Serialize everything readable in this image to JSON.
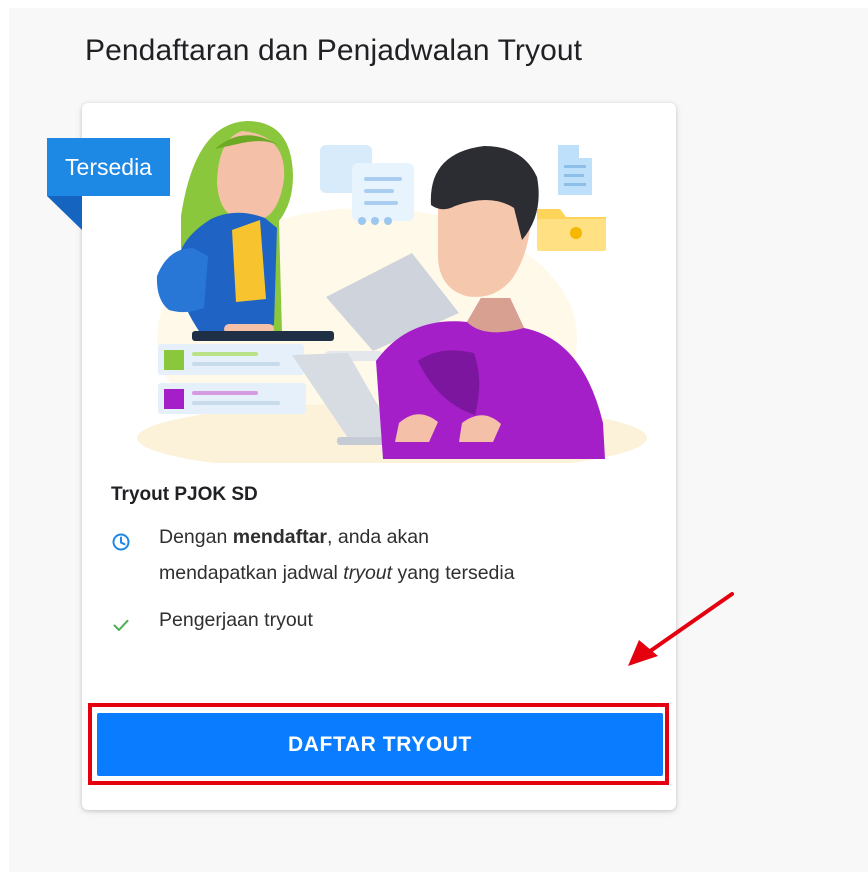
{
  "page": {
    "title": "Pendaftaran dan Penjadwalan Tryout"
  },
  "card": {
    "badge": "Tersedia",
    "tryout_title": "Tryout PJOK SD",
    "schedule_info": {
      "line1_prefix": "Dengan ",
      "line1_bold": "mendaftar",
      "line1_suffix": ", anda akan",
      "line2_prefix": "mendapatkan jadwal ",
      "line2_italic": "tryout",
      "line2_suffix": " yang tersedia",
      "icon": "clock-icon"
    },
    "work_info": {
      "label": "Pengerjaan tryout",
      "icon": "check-icon"
    },
    "button_label": "DAFTAR TRYOUT"
  },
  "colors": {
    "primary": "#0a7cff",
    "badge": "#1e88e5",
    "highlight": "#e5000f",
    "check": "#4caf50"
  }
}
